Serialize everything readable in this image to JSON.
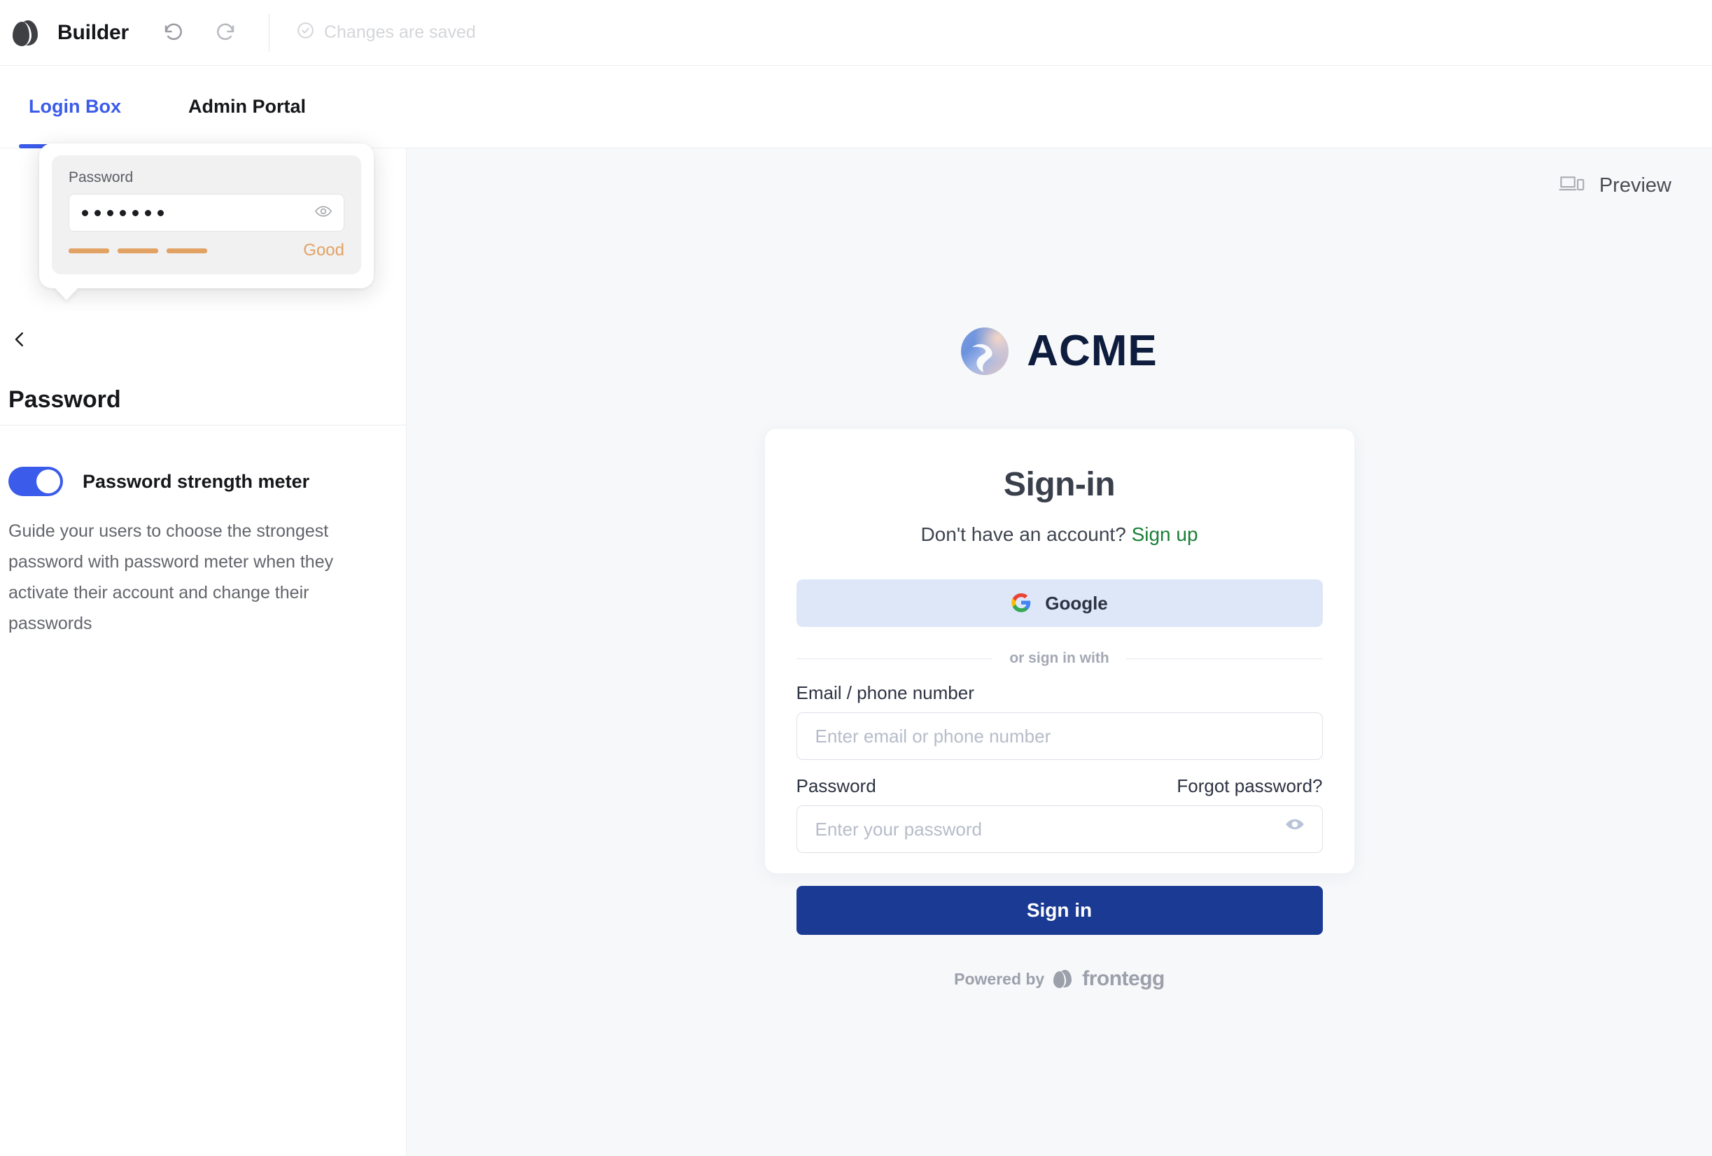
{
  "topbar": {
    "brand_title": "Builder",
    "undo_icon": "undo-icon",
    "redo_icon": "redo-icon",
    "status_text": "Changes are saved",
    "status_icon": "check-circle-icon",
    "status_color": "#d4d6da"
  },
  "tabs": [
    {
      "label": "Login Box",
      "active": true
    },
    {
      "label": "Admin Portal",
      "active": false
    }
  ],
  "sidebar": {
    "back_icon": "chevron-left-icon",
    "heading": "Password",
    "toggle": {
      "label": "Password strength meter",
      "on": true,
      "accent": "#3b5bea"
    },
    "description": "Guide your users to choose the strongest password with password meter when they activate their account and change their passwords"
  },
  "popover": {
    "label": "Password",
    "value_dots": 7,
    "eye_icon": "eye-icon",
    "meter": {
      "segments_total": 4,
      "segments_filled": 3,
      "strength_text": "Good",
      "color": "#e2a264"
    }
  },
  "preview": {
    "button_label": "Preview",
    "button_icon": "devices-icon",
    "background": "#f7f8fa"
  },
  "login": {
    "brand_name": "ACME",
    "brand_logo_icon": "acme-swirl-logo",
    "title": "Sign-in",
    "subtitle_text": "Don't have an account?",
    "signup_link": "Sign up",
    "signup_color": "#1a7f37",
    "social": {
      "google_label": "Google",
      "google_icon": "google-g-icon",
      "google_bg": "#dde7f7"
    },
    "divider_text": "or sign in with",
    "email": {
      "label": "Email / phone number",
      "placeholder": "Enter email or phone number",
      "value": ""
    },
    "password": {
      "label": "Password",
      "forgot_link": "Forgot password?",
      "placeholder": "Enter your password",
      "value": "",
      "eye_icon": "eye-icon"
    },
    "submit_label": "Sign in",
    "submit_color": "#1b3a93",
    "footer": {
      "powered_text": "Powered by",
      "vendor": "frontegg",
      "vendor_icon": "frontegg-egg-icon"
    }
  }
}
